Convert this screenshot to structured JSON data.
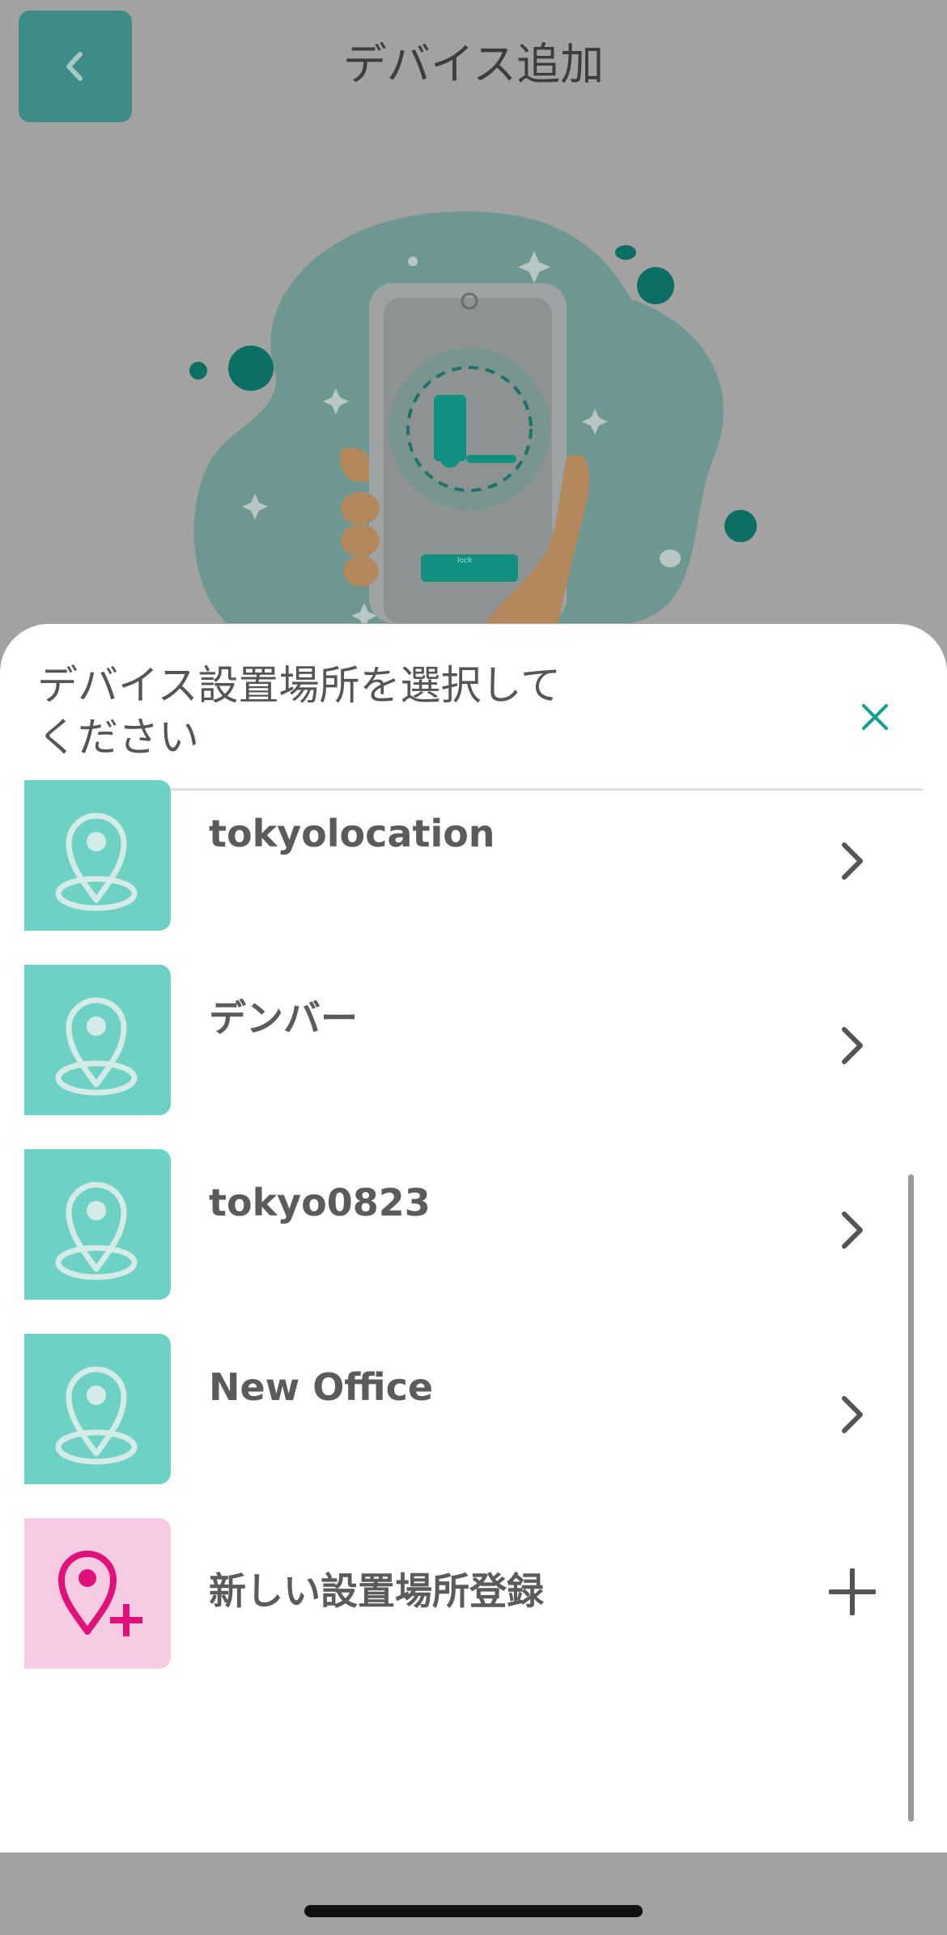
{
  "header": {
    "title": "デバイス追加",
    "back_icon": "chevron-left-icon"
  },
  "hero": {
    "illustration": "phone-in-hand-with-smart-lock-icon",
    "phone_button_text": "lock"
  },
  "sheet": {
    "title": "デバイス設置場所を選択して\nください",
    "close_icon": "close-icon",
    "locations": [
      {
        "label": "tokyolocation",
        "icon": "location-pin-icon"
      },
      {
        "label": "デンバー",
        "icon": "location-pin-icon"
      },
      {
        "label": "tokyo0823",
        "icon": "location-pin-icon"
      },
      {
        "label": "New Office",
        "icon": "location-pin-icon"
      }
    ],
    "add_location": {
      "label": "新しい設置場所登録",
      "icon": "location-pin-add-icon",
      "action_icon": "plus-icon"
    }
  },
  "colors": {
    "accent": "#0f9e8e",
    "tile_teal": "#6dd2c3",
    "tile_pink": "#f7cbe2",
    "pink_icon": "#e0127a",
    "overlay": "#a2a2a2"
  }
}
